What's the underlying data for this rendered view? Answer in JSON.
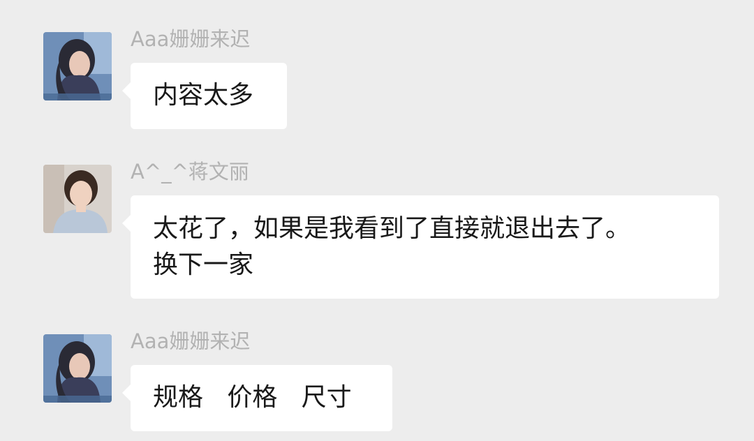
{
  "messages": [
    {
      "sender": "Aaa姗姗来迟",
      "avatar": "avatar-woman-long-hair-blue-bg",
      "lines": [
        "内容太多"
      ]
    },
    {
      "sender": "A^_^蒋文丽",
      "avatar": "avatar-woman-smiling-light-bg",
      "lines": [
        "太花了，如果是我看到了直接就退出去了。",
        "换下一家"
      ]
    },
    {
      "sender": "Aaa姗姗来迟",
      "avatar": "avatar-woman-long-hair-blue-bg",
      "lines": [
        "规格   价格   尺寸"
      ]
    }
  ],
  "colors": {
    "background": "#ededed",
    "bubble": "#ffffff",
    "sender_name": "#b2b2b2",
    "message_text": "#191919"
  }
}
